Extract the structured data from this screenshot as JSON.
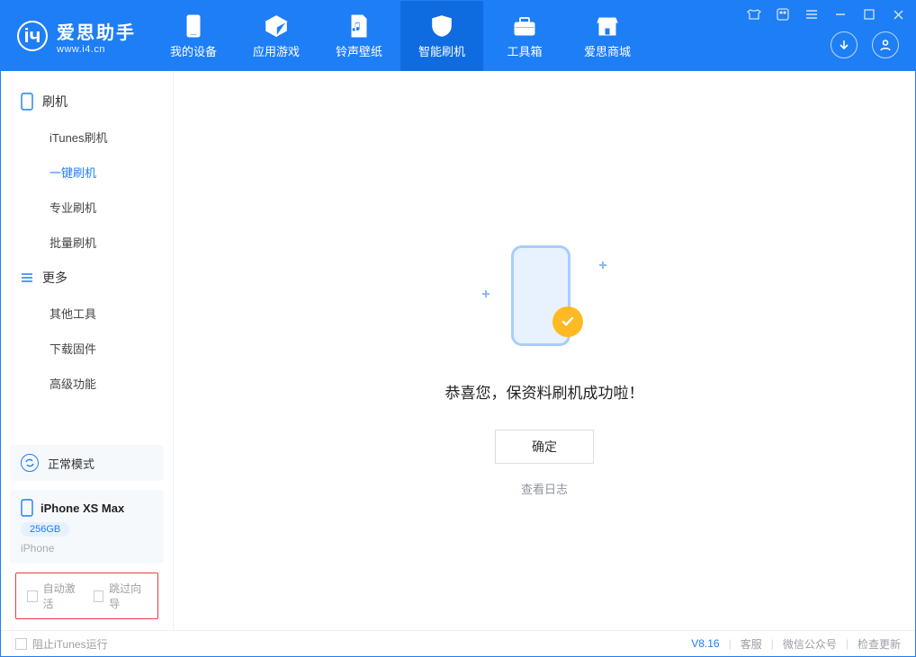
{
  "app": {
    "name_cn": "爱思助手",
    "url": "www.i4.cn"
  },
  "tabs": [
    {
      "label": "我的设备"
    },
    {
      "label": "应用游戏"
    },
    {
      "label": "铃声壁纸"
    },
    {
      "label": "智能刷机"
    },
    {
      "label": "工具箱"
    },
    {
      "label": "爱思商城"
    }
  ],
  "sidebar": {
    "group1_title": "刷机",
    "group1_items": [
      "iTunes刷机",
      "一键刷机",
      "专业刷机",
      "批量刷机"
    ],
    "group2_title": "更多",
    "group2_items": [
      "其他工具",
      "下载固件",
      "高级功能"
    ]
  },
  "mode_card": {
    "label": "正常模式"
  },
  "device_card": {
    "name": "iPhone XS Max",
    "storage": "256GB",
    "family": "iPhone"
  },
  "checkboxes": {
    "auto_activate": "自动激活",
    "skip_guide": "跳过向导"
  },
  "main": {
    "success_text": "恭喜您，保资料刷机成功啦！",
    "ok_button": "确定",
    "view_log": "查看日志"
  },
  "footer": {
    "block_itunes": "阻止iTunes运行",
    "version": "V8.16",
    "links": [
      "客服",
      "微信公众号",
      "检查更新"
    ]
  }
}
